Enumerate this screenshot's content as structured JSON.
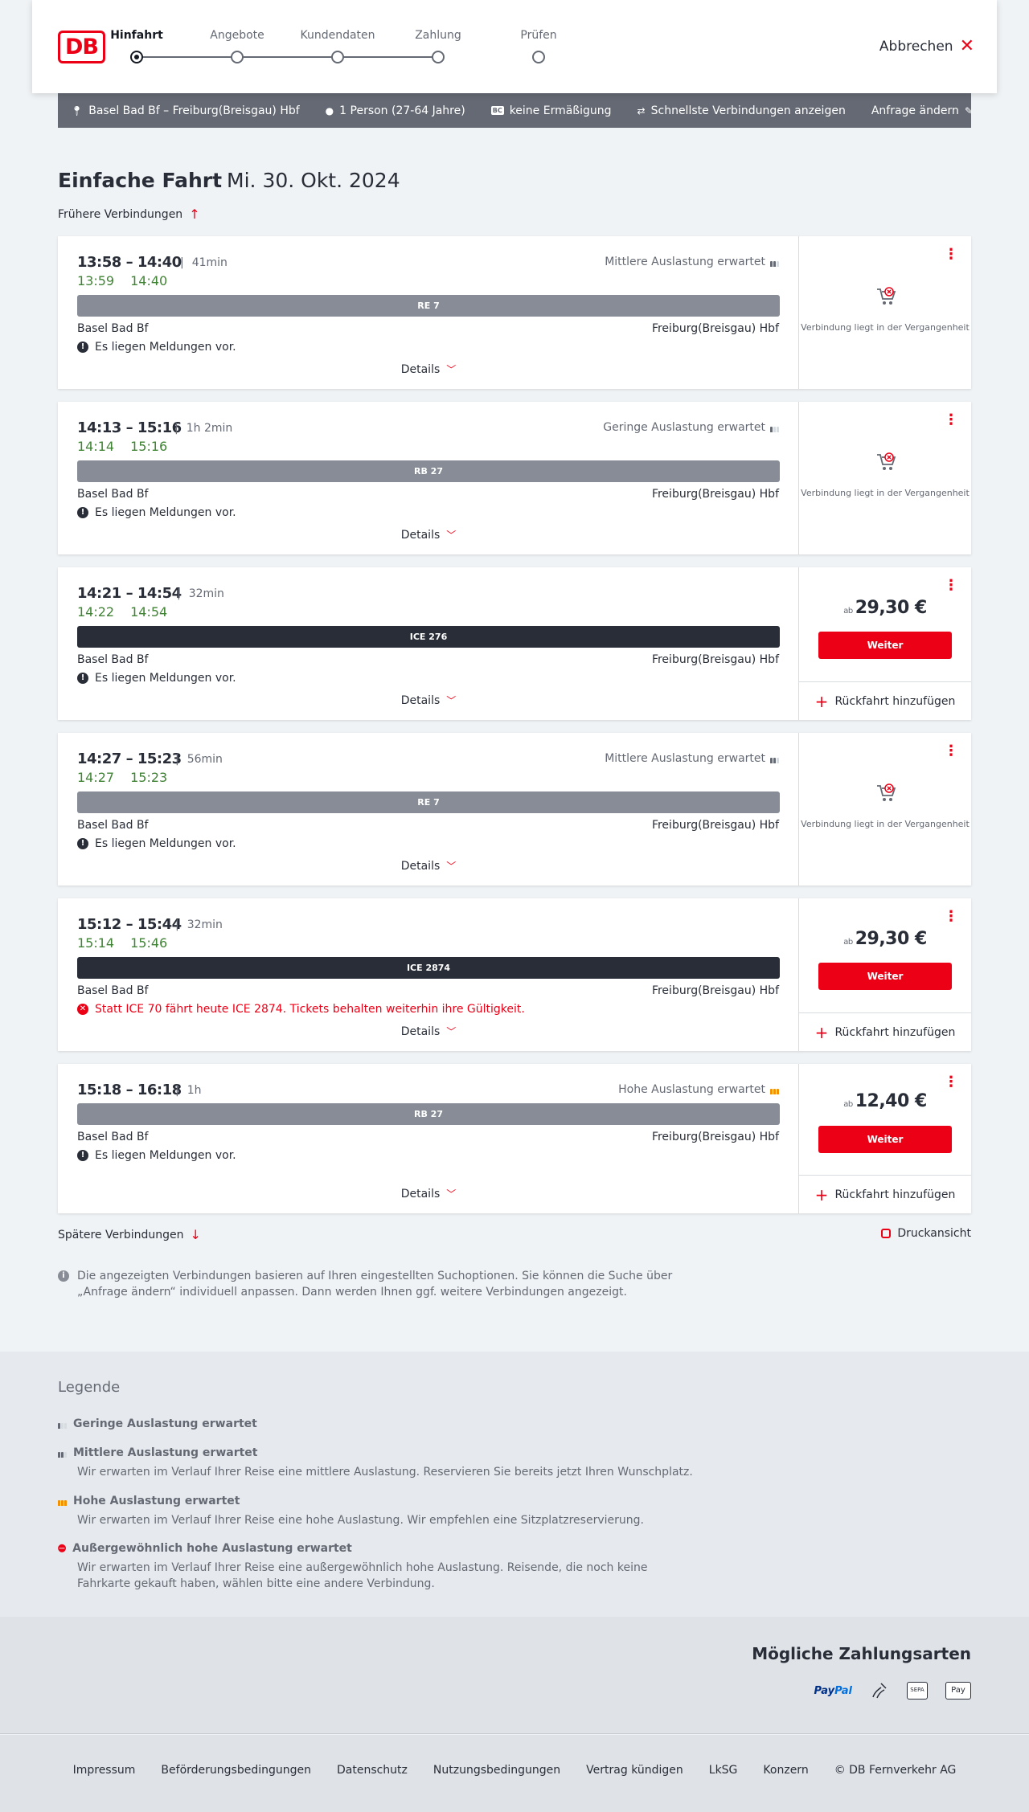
{
  "header": {
    "logo_text": "DB",
    "steps": [
      {
        "label": "Hinfahrt",
        "active": true
      },
      {
        "label": "Angebote",
        "active": false
      },
      {
        "label": "Kundendaten",
        "active": false
      },
      {
        "label": "Zahlung",
        "active": false
      },
      {
        "label": "Prüfen",
        "active": false
      }
    ],
    "cancel_label": "Abbrechen"
  },
  "searchbar": {
    "route": "Basel Bad Bf – Freiburg(Breisgau) Hbf",
    "passengers": "1 Person (27-64 Jahre)",
    "discount_badge": "BC",
    "discount": "keine Ermäßigung",
    "fastest": "Schnellste Verbindungen anzeigen",
    "change": "Anfrage ändern"
  },
  "page": {
    "title": "Einfache Fahrt",
    "date": "Mi. 30. Okt. 2024",
    "earlier": "Frühere Verbindungen",
    "later": "Spätere Verbindungen",
    "print": "Druckansicht",
    "note": "Die angezeigten Verbindungen basieren auf Ihren eingestellten Suchoptionen. Sie können die Suche über „Anfrage ändern“ individuell anpassen. Dann werden Ihnen ggf. weitere Verbindungen angezeigt."
  },
  "connections": [
    {
      "times": "13:58 – 14:40",
      "duration": "41min",
      "rt_dep": "13:59",
      "rt_arr": "14:40",
      "occupancy": "Mittlere Auslastung erwartet",
      "train": "RE 7",
      "from": "Basel Bad Bf",
      "to": "Freiburg(Breisgau) Hbf",
      "message": "Es liegen Meldungen vor.",
      "details": "Details",
      "past": "Verbindung liegt in der Vergangenheit"
    },
    {
      "times": "14:13 – 15:16",
      "duration": "1h 2min",
      "rt_dep": "14:14",
      "rt_arr": "15:16",
      "occupancy": "Geringe Auslastung erwartet",
      "train": "RB 27",
      "from": "Basel Bad Bf",
      "to": "Freiburg(Breisgau) Hbf",
      "message": "Es liegen Meldungen vor.",
      "details": "Details",
      "past": "Verbindung liegt in der Vergangenheit"
    },
    {
      "times": "14:21 – 14:54",
      "duration": "32min",
      "rt_dep": "14:22",
      "rt_arr": "14:54",
      "train": "ICE 276",
      "from": "Basel Bad Bf",
      "to": "Freiburg(Breisgau) Hbf",
      "message": "Es liegen Meldungen vor.",
      "details": "Details",
      "price_prefix": "ab",
      "price": "29,30 €",
      "weiter": "Weiter",
      "return": "Rückfahrt hinzufügen"
    },
    {
      "times": "14:27 – 15:23",
      "duration": "56min",
      "rt_dep": "14:27",
      "rt_arr": "15:23",
      "occupancy": "Mittlere Auslastung erwartet",
      "train": "RE 7",
      "from": "Basel Bad Bf",
      "to": "Freiburg(Breisgau) Hbf",
      "message": "Es liegen Meldungen vor.",
      "details": "Details",
      "past": "Verbindung liegt in der Vergangenheit"
    },
    {
      "times": "15:12 – 15:44",
      "duration": "32min",
      "rt_dep": "15:14",
      "rt_arr": "15:46",
      "train": "ICE 2874",
      "from": "Basel Bad Bf",
      "to": "Freiburg(Breisgau) Hbf",
      "message": "Statt ICE 70 fährt heute ICE 2874. Tickets behalten weiterhin ihre Gültigkeit.",
      "details": "Details",
      "price_prefix": "ab",
      "price": "29,30 €",
      "weiter": "Weiter",
      "return": "Rückfahrt hinzufügen"
    },
    {
      "times": "15:18 – 16:18",
      "duration": "1h",
      "occupancy": "Hohe Auslastung erwartet",
      "train": "RB 27",
      "from": "Basel Bad Bf",
      "to": "Freiburg(Breisgau) Hbf",
      "message": "Es liegen Meldungen vor.",
      "details": "Details",
      "price_prefix": "ab",
      "price": "12,40 €",
      "weiter": "Weiter",
      "return": "Rückfahrt hinzufügen"
    }
  ],
  "legend": {
    "title": "Legende",
    "items": [
      {
        "title": "Geringe Auslastung erwartet",
        "desc": ""
      },
      {
        "title": "Mittlere Auslastung erwartet",
        "desc": "Wir erwarten im Verlauf Ihrer Reise eine mittlere Auslastung. Reservieren Sie bereits jetzt Ihren Wunschplatz."
      },
      {
        "title": "Hohe Auslastung erwartet",
        "desc": "Wir erwarten im Verlauf Ihrer Reise eine hohe Auslastung. Wir empfehlen eine Sitzplatzreservierung."
      },
      {
        "title": "Außergewöhnlich hohe Auslastung erwartet",
        "desc": "Wir erwarten im Verlauf Ihrer Reise eine außergewöhnlich hohe Auslastung. Reisende, die noch keine Fahrkarte gekauft haben, wählen bitte eine andere Verbindung."
      }
    ]
  },
  "payments": {
    "title": "Mögliche Zahlungsarten",
    "paypal_a": "Pay",
    "paypal_b": "Pal",
    "sepa": "SEPA",
    "applepay": "Pay"
  },
  "footer": [
    "Impressum",
    "Beförderungsbedingungen",
    "Datenschutz",
    "Nutzungsbedingungen",
    "Vertrag kündigen",
    "LkSG",
    "Konzern",
    "© DB Fernverkehr AG"
  ],
  "colors": {
    "brand_red": "#ec0016",
    "realtime_green": "#408335",
    "bar_dark": "#282d37",
    "bar_grey": "#878c96"
  }
}
